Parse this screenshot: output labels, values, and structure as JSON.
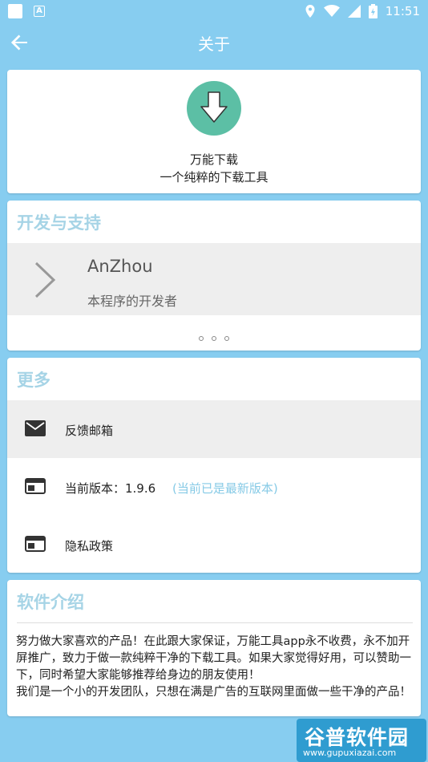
{
  "status_bar": {
    "time": "11:51"
  },
  "app_bar": {
    "title": "关于"
  },
  "hero": {
    "app_name": "万能下载",
    "slogan": "一个纯粹的下载工具"
  },
  "dev_section": {
    "title": "开发与支持",
    "developer_name": "AnZhou",
    "developer_role": "本程序的开发者"
  },
  "more_section": {
    "title": "更多",
    "feedback_label": "反馈邮箱",
    "version_label": "当前版本：1.9.6",
    "version_status": "(当前已是最新版本)",
    "privacy_label": "隐私政策"
  },
  "intro_section": {
    "title": "软件介绍",
    "paragraph1": "努力做大家喜欢的产品！在此跟大家保证，万能工具app永不收费，永不加开屏推广，致力于做一款纯粹干净的下载工具。如果大家觉得好用，可以赞助一下，同时希望大家能够推荐给身边的朋友使用！",
    "paragraph2": "我们是一个小的开发团队，只想在满是广告的互联网里面做一些干净的产品！"
  },
  "watermark": {
    "main": "谷普软件园",
    "url": "www.gupuxiazai.com"
  },
  "colors": {
    "background": "#87cdf0",
    "accent": "#a6d4e6",
    "logo": "#5cbfa5",
    "link": "#86cae6"
  }
}
